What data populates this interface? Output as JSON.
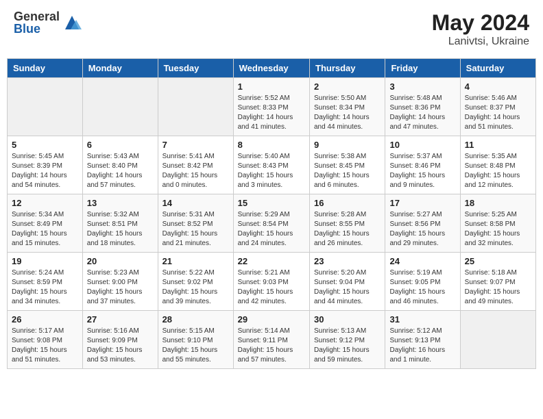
{
  "header": {
    "logo_general": "General",
    "logo_blue": "Blue",
    "month_year": "May 2024",
    "location": "Lanivtsi, Ukraine"
  },
  "weekdays": [
    "Sunday",
    "Monday",
    "Tuesday",
    "Wednesday",
    "Thursday",
    "Friday",
    "Saturday"
  ],
  "weeks": [
    [
      {
        "day": "",
        "info": ""
      },
      {
        "day": "",
        "info": ""
      },
      {
        "day": "",
        "info": ""
      },
      {
        "day": "1",
        "info": "Sunrise: 5:52 AM\nSunset: 8:33 PM\nDaylight: 14 hours\nand 41 minutes."
      },
      {
        "day": "2",
        "info": "Sunrise: 5:50 AM\nSunset: 8:34 PM\nDaylight: 14 hours\nand 44 minutes."
      },
      {
        "day": "3",
        "info": "Sunrise: 5:48 AM\nSunset: 8:36 PM\nDaylight: 14 hours\nand 47 minutes."
      },
      {
        "day": "4",
        "info": "Sunrise: 5:46 AM\nSunset: 8:37 PM\nDaylight: 14 hours\nand 51 minutes."
      }
    ],
    [
      {
        "day": "5",
        "info": "Sunrise: 5:45 AM\nSunset: 8:39 PM\nDaylight: 14 hours\nand 54 minutes."
      },
      {
        "day": "6",
        "info": "Sunrise: 5:43 AM\nSunset: 8:40 PM\nDaylight: 14 hours\nand 57 minutes."
      },
      {
        "day": "7",
        "info": "Sunrise: 5:41 AM\nSunset: 8:42 PM\nDaylight: 15 hours\nand 0 minutes."
      },
      {
        "day": "8",
        "info": "Sunrise: 5:40 AM\nSunset: 8:43 PM\nDaylight: 15 hours\nand 3 minutes."
      },
      {
        "day": "9",
        "info": "Sunrise: 5:38 AM\nSunset: 8:45 PM\nDaylight: 15 hours\nand 6 minutes."
      },
      {
        "day": "10",
        "info": "Sunrise: 5:37 AM\nSunset: 8:46 PM\nDaylight: 15 hours\nand 9 minutes."
      },
      {
        "day": "11",
        "info": "Sunrise: 5:35 AM\nSunset: 8:48 PM\nDaylight: 15 hours\nand 12 minutes."
      }
    ],
    [
      {
        "day": "12",
        "info": "Sunrise: 5:34 AM\nSunset: 8:49 PM\nDaylight: 15 hours\nand 15 minutes."
      },
      {
        "day": "13",
        "info": "Sunrise: 5:32 AM\nSunset: 8:51 PM\nDaylight: 15 hours\nand 18 minutes."
      },
      {
        "day": "14",
        "info": "Sunrise: 5:31 AM\nSunset: 8:52 PM\nDaylight: 15 hours\nand 21 minutes."
      },
      {
        "day": "15",
        "info": "Sunrise: 5:29 AM\nSunset: 8:54 PM\nDaylight: 15 hours\nand 24 minutes."
      },
      {
        "day": "16",
        "info": "Sunrise: 5:28 AM\nSunset: 8:55 PM\nDaylight: 15 hours\nand 26 minutes."
      },
      {
        "day": "17",
        "info": "Sunrise: 5:27 AM\nSunset: 8:56 PM\nDaylight: 15 hours\nand 29 minutes."
      },
      {
        "day": "18",
        "info": "Sunrise: 5:25 AM\nSunset: 8:58 PM\nDaylight: 15 hours\nand 32 minutes."
      }
    ],
    [
      {
        "day": "19",
        "info": "Sunrise: 5:24 AM\nSunset: 8:59 PM\nDaylight: 15 hours\nand 34 minutes."
      },
      {
        "day": "20",
        "info": "Sunrise: 5:23 AM\nSunset: 9:00 PM\nDaylight: 15 hours\nand 37 minutes."
      },
      {
        "day": "21",
        "info": "Sunrise: 5:22 AM\nSunset: 9:02 PM\nDaylight: 15 hours\nand 39 minutes."
      },
      {
        "day": "22",
        "info": "Sunrise: 5:21 AM\nSunset: 9:03 PM\nDaylight: 15 hours\nand 42 minutes."
      },
      {
        "day": "23",
        "info": "Sunrise: 5:20 AM\nSunset: 9:04 PM\nDaylight: 15 hours\nand 44 minutes."
      },
      {
        "day": "24",
        "info": "Sunrise: 5:19 AM\nSunset: 9:05 PM\nDaylight: 15 hours\nand 46 minutes."
      },
      {
        "day": "25",
        "info": "Sunrise: 5:18 AM\nSunset: 9:07 PM\nDaylight: 15 hours\nand 49 minutes."
      }
    ],
    [
      {
        "day": "26",
        "info": "Sunrise: 5:17 AM\nSunset: 9:08 PM\nDaylight: 15 hours\nand 51 minutes."
      },
      {
        "day": "27",
        "info": "Sunrise: 5:16 AM\nSunset: 9:09 PM\nDaylight: 15 hours\nand 53 minutes."
      },
      {
        "day": "28",
        "info": "Sunrise: 5:15 AM\nSunset: 9:10 PM\nDaylight: 15 hours\nand 55 minutes."
      },
      {
        "day": "29",
        "info": "Sunrise: 5:14 AM\nSunset: 9:11 PM\nDaylight: 15 hours\nand 57 minutes."
      },
      {
        "day": "30",
        "info": "Sunrise: 5:13 AM\nSunset: 9:12 PM\nDaylight: 15 hours\nand 59 minutes."
      },
      {
        "day": "31",
        "info": "Sunrise: 5:12 AM\nSunset: 9:13 PM\nDaylight: 16 hours\nand 1 minute."
      },
      {
        "day": "",
        "info": ""
      }
    ]
  ]
}
